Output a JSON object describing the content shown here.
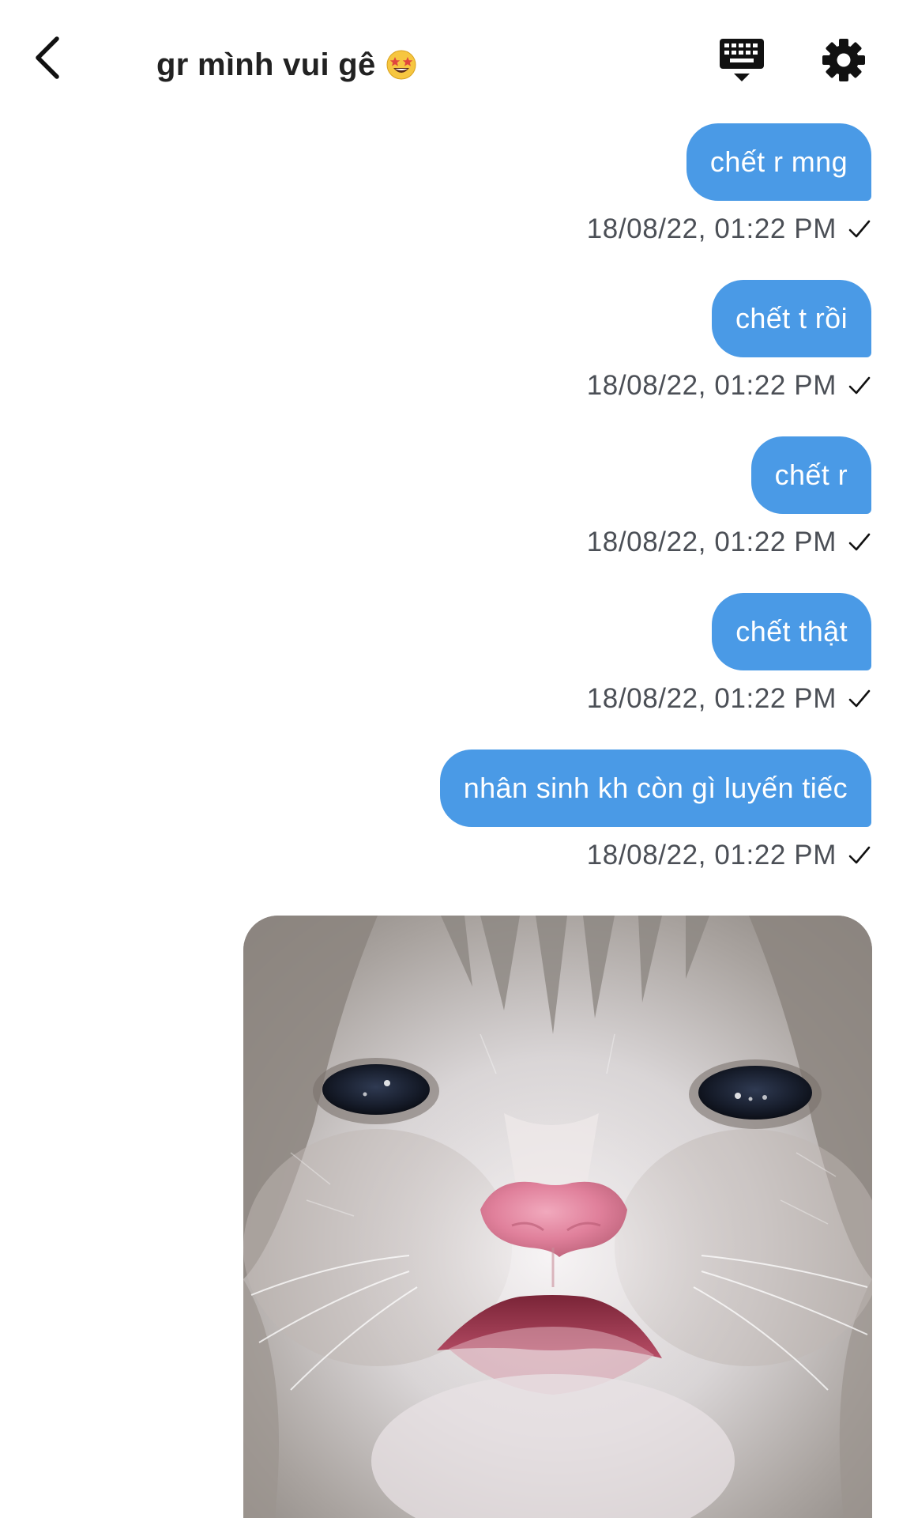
{
  "header": {
    "title": "gr mình vui gê",
    "back_icon": "chevron-left-icon",
    "title_emoji_icon": "star-struck-emoji-icon",
    "keyboard_icon": "keyboard-icon",
    "settings_icon": "gear-icon"
  },
  "colors": {
    "bubble": "#4a9ae6",
    "bubble_text": "#ffffff",
    "timestamp": "#4b4f56",
    "background": "#ffffff"
  },
  "messages": [
    {
      "text": "chết r mng",
      "timestamp": "18/08/22, 01:22 PM",
      "status_icon": "check-icon"
    },
    {
      "text": "chết t rồi",
      "timestamp": "18/08/22, 01:22 PM",
      "status_icon": "check-icon"
    },
    {
      "text": "chết r",
      "timestamp": "18/08/22, 01:22 PM",
      "status_icon": "check-icon"
    },
    {
      "text": "chết thật",
      "timestamp": "18/08/22, 01:22 PM",
      "status_icon": "check-icon"
    },
    {
      "text": "nhân sinh kh còn gì luyến tiếc",
      "timestamp": "18/08/22, 01:22 PM",
      "status_icon": "check-icon"
    }
  ],
  "image_message": {
    "icon": "crying-kitten-photo"
  }
}
